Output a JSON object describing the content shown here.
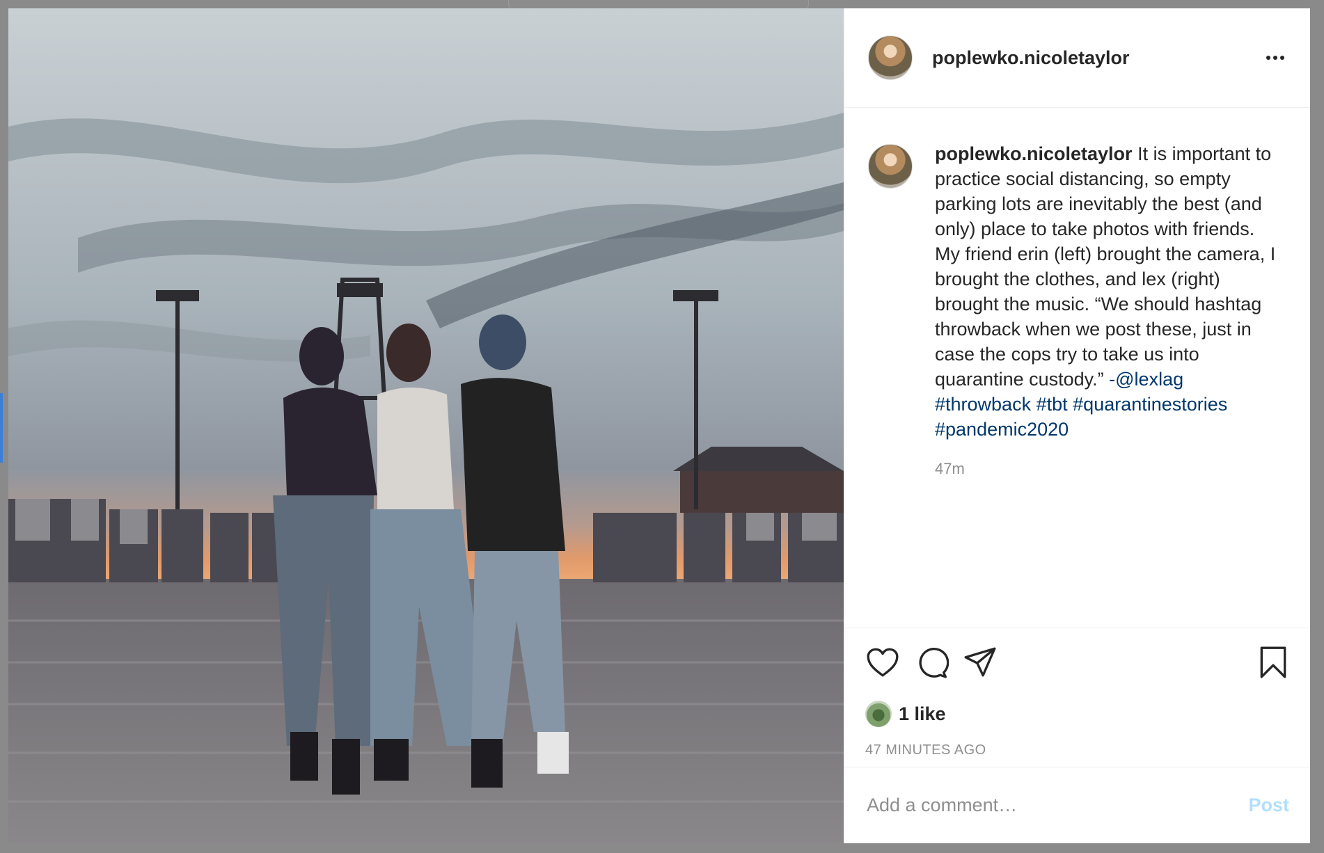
{
  "post": {
    "username": "poplewko.nicoletaylor",
    "caption": {
      "username": "poplewko.nicoletaylor",
      "text": " It is important to practice social distancing, so empty parking lots are inevitably the best (and only) place to take photos with friends. My friend erin (left) brought the camera, I brought the clothes, and lex (right) brought the music. “We should hashtag throwback when we post these, just in case the cops try to take us into quarantine custody.” ",
      "mention": "-@lexlag",
      "hashtags": [
        "#throwback",
        "#tbt",
        "#quarantinestories",
        "#pandemic2020"
      ]
    },
    "relative_time": "47m",
    "likes_label": "1 like",
    "absolute_time": "47 MINUTES AGO"
  },
  "comment": {
    "placeholder": "Add a comment…",
    "post_label": "Post"
  },
  "icons": {
    "more": "more-options-icon",
    "like": "heart-icon",
    "comment": "comment-icon",
    "share": "send-icon",
    "save": "bookmark-icon"
  },
  "colors": {
    "text": "#262626",
    "secondary": "#8e8e8e",
    "link": "#00376b",
    "post_button_disabled": "#b2dffc"
  }
}
